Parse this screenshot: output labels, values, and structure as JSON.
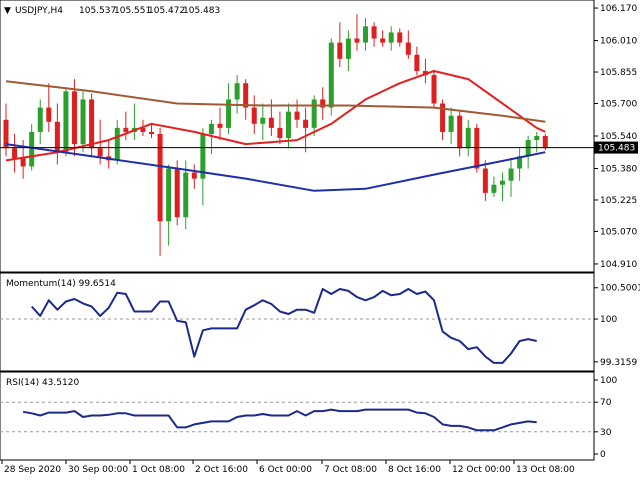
{
  "header": {
    "symbol": "USDJPY,H4",
    "open": "105.537",
    "high": "105.551",
    "low": "105.472",
    "close": "105.483"
  },
  "main_panel": {
    "price_ticks": [
      "106.170",
      "106.010",
      "105.855",
      "105.700",
      "105.540",
      "105.380",
      "105.225",
      "105.070",
      "104.910"
    ],
    "current_price_label": "105.483",
    "current_price": 105.483
  },
  "momentum_panel": {
    "label": "Momentum(14) 99.6514",
    "ticks": [
      "100.5001",
      "100",
      "99.3159"
    ]
  },
  "rsi_panel": {
    "label": "RSI(14) 43.5120",
    "ticks": [
      "100",
      "70",
      "30",
      "0"
    ]
  },
  "time_axis": {
    "labels": [
      "28 Sep 2020",
      "30 Sep 00:00",
      "1 Oct 08:00",
      "2 Oct 16:00",
      "6 Oct 00:00",
      "7 Oct 08:00",
      "8 Oct 16:00",
      "12 Oct 00:00",
      "13 Oct 08:00"
    ]
  },
  "colors": {
    "bull": "#2ca02c",
    "bear": "#dd1f1f",
    "ma_fast": "#e52020",
    "ma_mid": "#a05a33",
    "ma_slow": "#1f2fa8",
    "indicator": "#1c2a8c",
    "grid_dash": "#999999"
  },
  "chart_data": [
    {
      "type": "candlestick",
      "title": "USDJPY,H4",
      "ylim": [
        104.89,
        106.19
      ],
      "candles": [
        {
          "o": 105.62,
          "h": 105.7,
          "l": 105.44,
          "c": 105.48
        },
        {
          "o": 105.48,
          "h": 105.55,
          "l": 105.36,
          "c": 105.43
        },
        {
          "o": 105.43,
          "h": 105.52,
          "l": 105.33,
          "c": 105.39
        },
        {
          "o": 105.39,
          "h": 105.6,
          "l": 105.37,
          "c": 105.56
        },
        {
          "o": 105.56,
          "h": 105.72,
          "l": 105.5,
          "c": 105.68
        },
        {
          "o": 105.68,
          "h": 105.8,
          "l": 105.56,
          "c": 105.61
        },
        {
          "o": 105.61,
          "h": 105.7,
          "l": 105.4,
          "c": 105.46
        },
        {
          "o": 105.46,
          "h": 105.78,
          "l": 105.44,
          "c": 105.76
        },
        {
          "o": 105.76,
          "h": 105.82,
          "l": 105.44,
          "c": 105.5
        },
        {
          "o": 105.5,
          "h": 105.76,
          "l": 105.46,
          "c": 105.72
        },
        {
          "o": 105.72,
          "h": 105.75,
          "l": 105.44,
          "c": 105.48
        },
        {
          "o": 105.48,
          "h": 105.62,
          "l": 105.4,
          "c": 105.44
        },
        {
          "o": 105.44,
          "h": 105.52,
          "l": 105.38,
          "c": 105.42
        },
        {
          "o": 105.42,
          "h": 105.62,
          "l": 105.4,
          "c": 105.58
        },
        {
          "o": 105.58,
          "h": 105.66,
          "l": 105.52,
          "c": 105.56
        },
        {
          "o": 105.56,
          "h": 105.7,
          "l": 105.52,
          "c": 105.58
        },
        {
          "o": 105.58,
          "h": 105.62,
          "l": 105.54,
          "c": 105.56
        },
        {
          "o": 105.56,
          "h": 105.6,
          "l": 105.53,
          "c": 105.55
        },
        {
          "o": 105.55,
          "h": 105.58,
          "l": 104.95,
          "c": 105.12
        },
        {
          "o": 105.12,
          "h": 105.4,
          "l": 105.0,
          "c": 105.38
        },
        {
          "o": 105.38,
          "h": 105.42,
          "l": 105.1,
          "c": 105.14
        },
        {
          "o": 105.14,
          "h": 105.42,
          "l": 105.08,
          "c": 105.36
        },
        {
          "o": 105.36,
          "h": 105.4,
          "l": 105.28,
          "c": 105.33
        },
        {
          "o": 105.33,
          "h": 105.58,
          "l": 105.2,
          "c": 105.55
        },
        {
          "o": 105.55,
          "h": 105.62,
          "l": 105.45,
          "c": 105.6
        },
        {
          "o": 105.6,
          "h": 105.68,
          "l": 105.52,
          "c": 105.58
        },
        {
          "o": 105.58,
          "h": 105.8,
          "l": 105.55,
          "c": 105.72
        },
        {
          "o": 105.72,
          "h": 105.84,
          "l": 105.65,
          "c": 105.8
        },
        {
          "o": 105.8,
          "h": 105.82,
          "l": 105.62,
          "c": 105.68
        },
        {
          "o": 105.68,
          "h": 105.74,
          "l": 105.55,
          "c": 105.6
        },
        {
          "o": 105.6,
          "h": 105.7,
          "l": 105.52,
          "c": 105.63
        },
        {
          "o": 105.63,
          "h": 105.72,
          "l": 105.54,
          "c": 105.58
        },
        {
          "o": 105.58,
          "h": 105.66,
          "l": 105.5,
          "c": 105.53
        },
        {
          "o": 105.53,
          "h": 105.7,
          "l": 105.48,
          "c": 105.66
        },
        {
          "o": 105.66,
          "h": 105.72,
          "l": 105.58,
          "c": 105.62
        },
        {
          "o": 105.62,
          "h": 105.68,
          "l": 105.46,
          "c": 105.58
        },
        {
          "o": 105.58,
          "h": 105.74,
          "l": 105.54,
          "c": 105.72
        },
        {
          "o": 105.72,
          "h": 105.78,
          "l": 105.62,
          "c": 105.68
        },
        {
          "o": 105.68,
          "h": 106.02,
          "l": 105.64,
          "c": 106.0
        },
        {
          "o": 106.0,
          "h": 106.1,
          "l": 105.88,
          "c": 105.92
        },
        {
          "o": 105.92,
          "h": 106.06,
          "l": 105.86,
          "c": 106.02
        },
        {
          "o": 106.02,
          "h": 106.14,
          "l": 105.96,
          "c": 106.0
        },
        {
          "o": 106.0,
          "h": 106.12,
          "l": 105.96,
          "c": 106.08
        },
        {
          "o": 106.08,
          "h": 106.1,
          "l": 105.98,
          "c": 106.02
        },
        {
          "o": 106.02,
          "h": 106.06,
          "l": 105.98,
          "c": 106.0
        },
        {
          "o": 106.0,
          "h": 106.08,
          "l": 105.96,
          "c": 106.05
        },
        {
          "o": 106.05,
          "h": 106.07,
          "l": 105.98,
          "c": 106.0
        },
        {
          "o": 106.0,
          "h": 106.06,
          "l": 105.92,
          "c": 105.94
        },
        {
          "o": 105.94,
          "h": 105.98,
          "l": 105.84,
          "c": 105.86
        },
        {
          "o": 105.86,
          "h": 105.92,
          "l": 105.8,
          "c": 105.84
        },
        {
          "o": 105.84,
          "h": 105.86,
          "l": 105.68,
          "c": 105.7
        },
        {
          "o": 105.7,
          "h": 105.72,
          "l": 105.52,
          "c": 105.56
        },
        {
          "o": 105.56,
          "h": 105.68,
          "l": 105.5,
          "c": 105.64
        },
        {
          "o": 105.64,
          "h": 105.66,
          "l": 105.44,
          "c": 105.48
        },
        {
          "o": 105.48,
          "h": 105.62,
          "l": 105.44,
          "c": 105.58
        },
        {
          "o": 105.58,
          "h": 105.6,
          "l": 105.36,
          "c": 105.38
        },
        {
          "o": 105.38,
          "h": 105.42,
          "l": 105.22,
          "c": 105.26
        },
        {
          "o": 105.26,
          "h": 105.34,
          "l": 105.24,
          "c": 105.3
        },
        {
          "o": 105.3,
          "h": 105.36,
          "l": 105.22,
          "c": 105.32
        },
        {
          "o": 105.32,
          "h": 105.42,
          "l": 105.24,
          "c": 105.38
        },
        {
          "o": 105.38,
          "h": 105.48,
          "l": 105.32,
          "c": 105.44
        },
        {
          "o": 105.44,
          "h": 105.54,
          "l": 105.38,
          "c": 105.52
        },
        {
          "o": 105.52,
          "h": 105.56,
          "l": 105.46,
          "c": 105.54
        },
        {
          "o": 105.54,
          "h": 105.55,
          "l": 105.47,
          "c": 105.48
        }
      ],
      "overlays": [
        {
          "name": "fast MA",
          "color": "#e52020",
          "points": [
            [
              0,
              105.42
            ],
            [
              6,
              105.46
            ],
            [
              12,
              105.52
            ],
            [
              17,
              105.6
            ],
            [
              22,
              105.56
            ],
            [
              28,
              105.5
            ],
            [
              34,
              105.52
            ],
            [
              38,
              105.6
            ],
            [
              42,
              105.72
            ],
            [
              46,
              105.8
            ],
            [
              50,
              105.86
            ],
            [
              54,
              105.82
            ],
            [
              58,
              105.7
            ],
            [
              62,
              105.58
            ],
            [
              63,
              105.56
            ]
          ]
        },
        {
          "name": "mid MA",
          "color": "#a05a33",
          "points": [
            [
              0,
              105.81
            ],
            [
              10,
              105.76
            ],
            [
              20,
              105.7
            ],
            [
              30,
              105.69
            ],
            [
              40,
              105.69
            ],
            [
              50,
              105.68
            ],
            [
              58,
              105.64
            ],
            [
              63,
              105.61
            ]
          ]
        },
        {
          "name": "slow MA",
          "color": "#1f2fa8",
          "points": [
            [
              0,
              105.5
            ],
            [
              10,
              105.44
            ],
            [
              20,
              105.38
            ],
            [
              28,
              105.33
            ],
            [
              36,
              105.27
            ],
            [
              42,
              105.28
            ],
            [
              50,
              105.35
            ],
            [
              56,
              105.4
            ],
            [
              63,
              105.46
            ]
          ]
        }
      ]
    },
    {
      "type": "line",
      "title": "Momentum(14) 99.6514",
      "ylim": [
        99.25,
        100.56
      ],
      "values": [
        100.2,
        100.05,
        100.3,
        100.15,
        100.28,
        100.32,
        100.25,
        100.2,
        100.05,
        100.18,
        100.42,
        100.4,
        100.12,
        100.12,
        100.12,
        100.28,
        100.28,
        99.97,
        99.95,
        99.4,
        99.82,
        99.85,
        99.85,
        99.85,
        99.85,
        100.15,
        100.22,
        100.3,
        100.24,
        100.12,
        100.08,
        100.15,
        100.15,
        100.1,
        100.48,
        100.4,
        100.48,
        100.45,
        100.35,
        100.3,
        100.35,
        100.45,
        100.38,
        100.4,
        100.48,
        100.4,
        100.44,
        100.3,
        99.8,
        99.7,
        99.65,
        99.52,
        99.55,
        99.4,
        99.3,
        99.3,
        99.45,
        99.65,
        99.68,
        99.65
      ]
    },
    {
      "type": "line",
      "title": "RSI(14) 43.5120",
      "ylim": [
        0,
        100
      ],
      "values": [
        57,
        55,
        52,
        56,
        56,
        56,
        58,
        50,
        52,
        52,
        53,
        55,
        55,
        52,
        52,
        52,
        52,
        52,
        36,
        36,
        40,
        42,
        44,
        44,
        44,
        50,
        52,
        52,
        54,
        52,
        52,
        52,
        58,
        52,
        58,
        58,
        60,
        58,
        58,
        58,
        60,
        60,
        60,
        60,
        60,
        60,
        56,
        55,
        50,
        40,
        38,
        38,
        36,
        32,
        32,
        32,
        36,
        40,
        42,
        44,
        43
      ]
    }
  ]
}
